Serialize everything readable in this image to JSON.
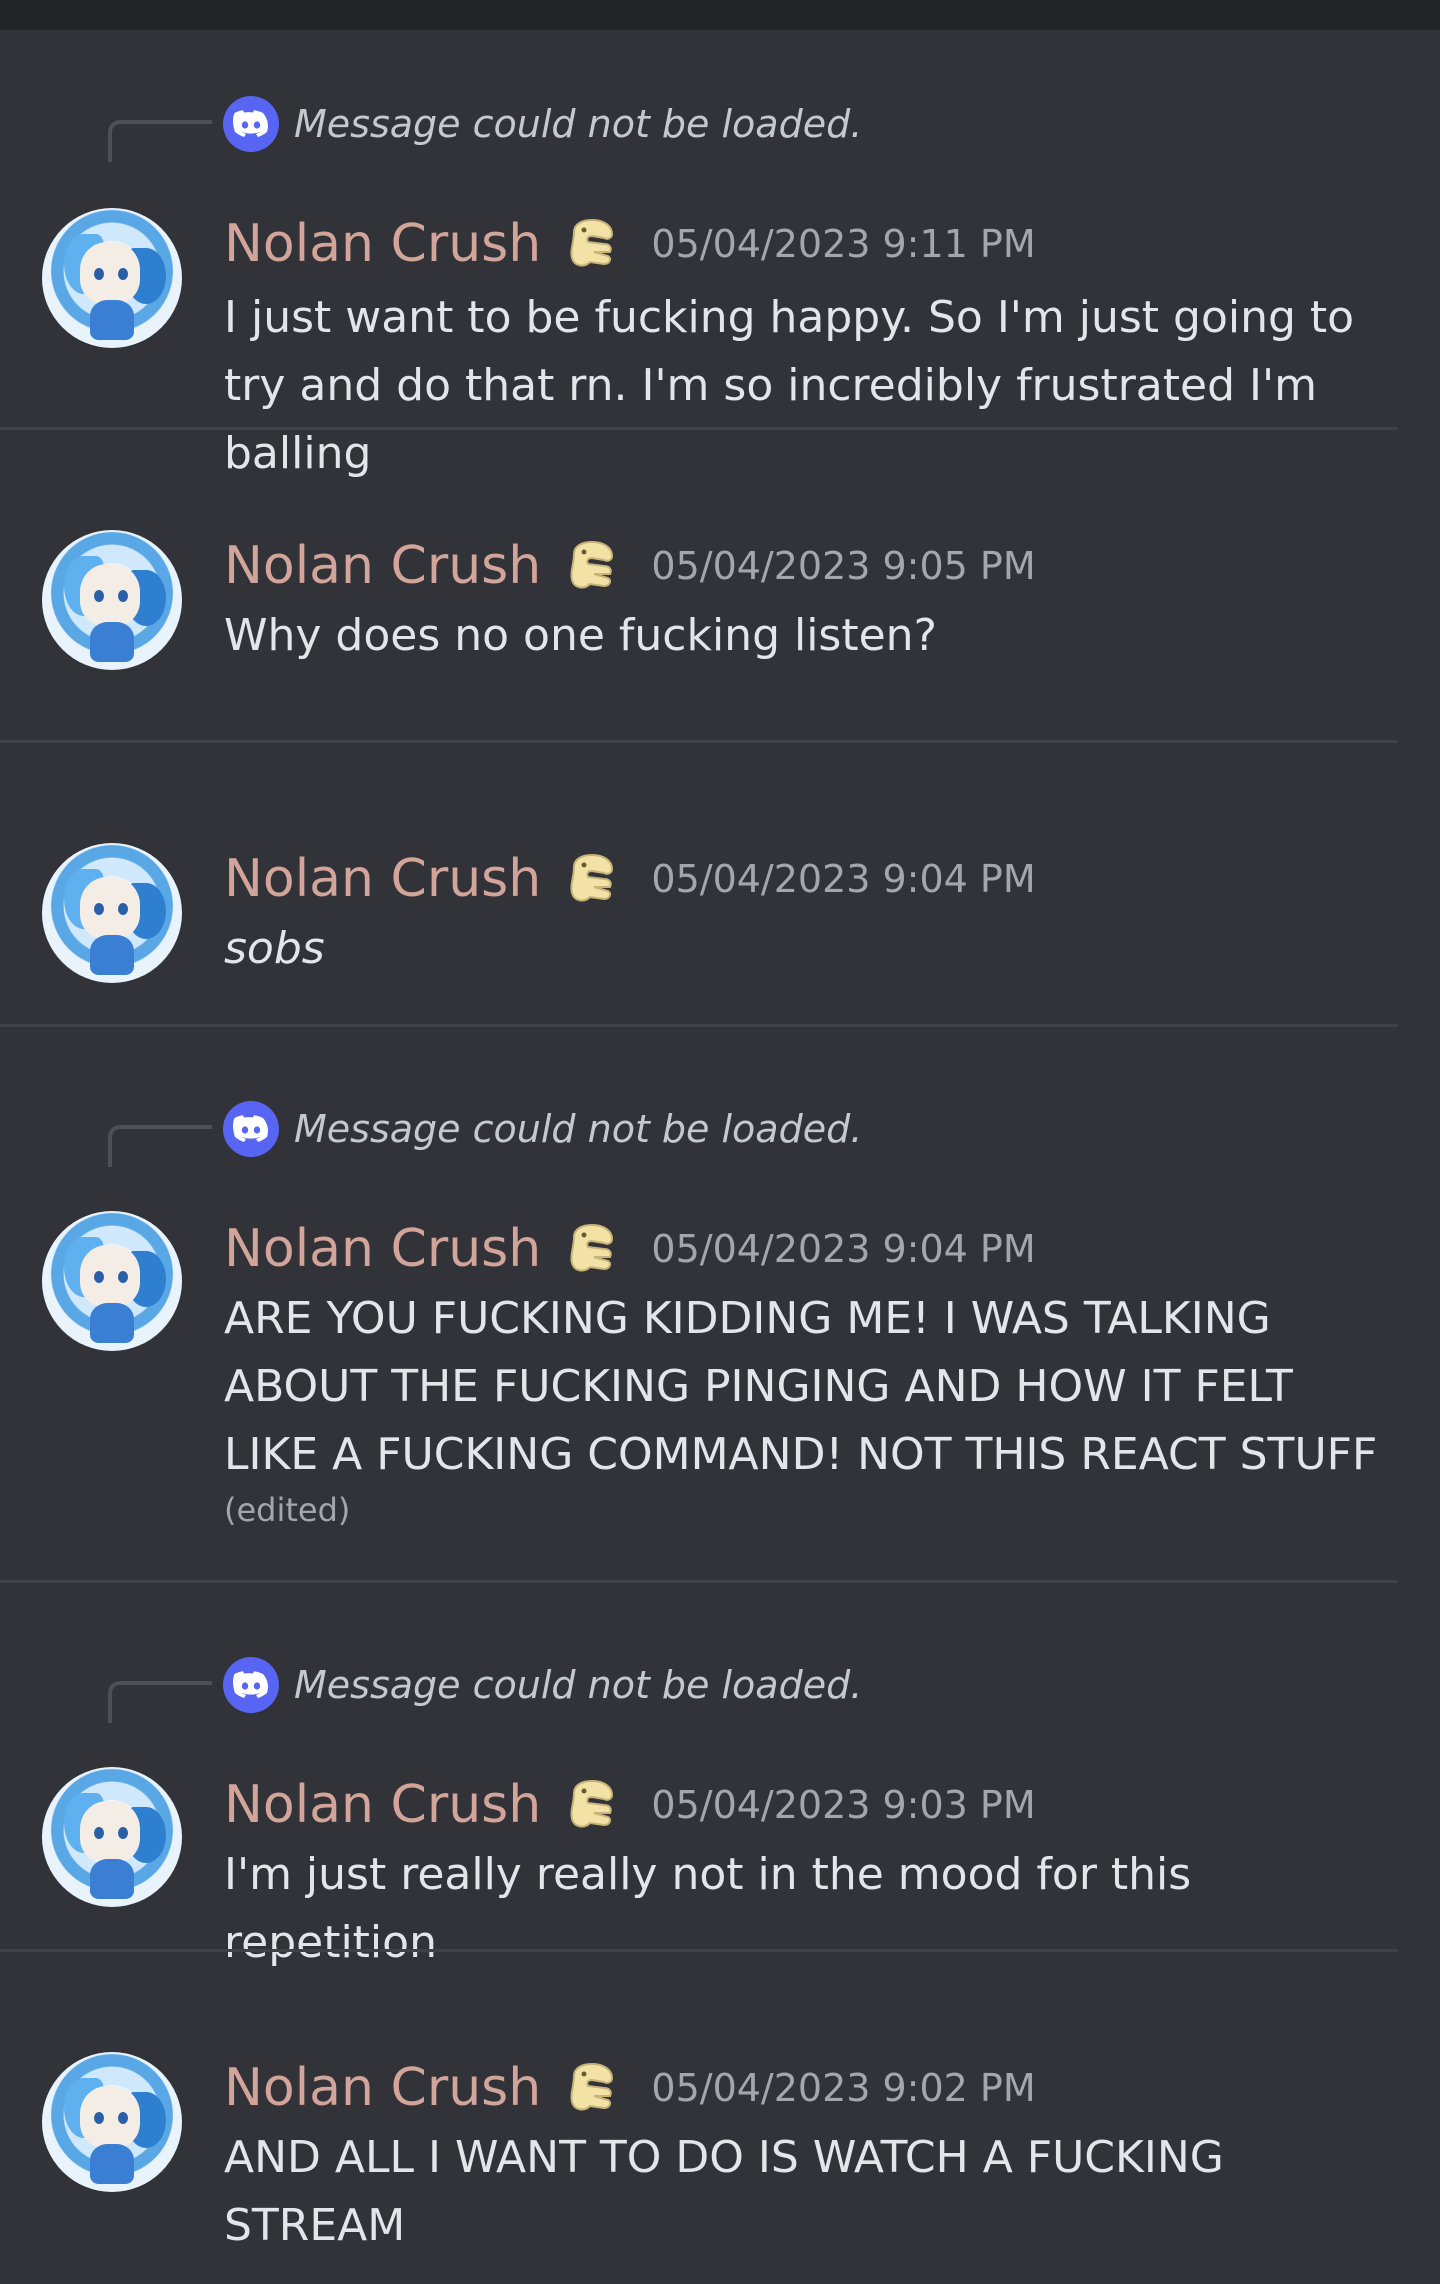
{
  "reply_placeholder": "Message could not be loaded.",
  "messages": [
    {
      "author": "Nolan Crush",
      "timestamp": "05/04/2023 9:11 PM",
      "text": "I just want to be fucking happy. So I'm just going to try and do that rn. I'm so incredibly frustrated I'm balling",
      "has_reply": true,
      "italic": false,
      "edited": ""
    },
    {
      "author": "Nolan Crush",
      "timestamp": "05/04/2023 9:05 PM",
      "text": "Why does no one fucking listen?",
      "has_reply": false,
      "italic": false,
      "edited": ""
    },
    {
      "author": "Nolan Crush",
      "timestamp": "05/04/2023 9:04 PM",
      "text": "sobs",
      "has_reply": false,
      "italic": true,
      "edited": ""
    },
    {
      "author": "Nolan Crush",
      "timestamp": "05/04/2023 9:04 PM",
      "text": "ARE YOU FUCKING KIDDING ME! I WAS TALKING ABOUT THE FUCKING PINGING AND HOW IT FELT LIKE A FUCKING COMMAND! NOT THIS REACT STUFF",
      "has_reply": true,
      "italic": false,
      "edited": "(edited)"
    },
    {
      "author": "Nolan Crush",
      "timestamp": "05/04/2023 9:03 PM",
      "text": "I'm just really really not in the mood for this repetition",
      "has_reply": true,
      "italic": false,
      "edited": ""
    },
    {
      "author": "Nolan Crush",
      "timestamp": "05/04/2023 9:02 PM",
      "text": "AND ALL I WANT TO DO IS WATCH A FUCKING STREAM",
      "has_reply": false,
      "italic": false,
      "edited": ""
    }
  ],
  "colors": {
    "background": "#313338",
    "author": "#d2a49a",
    "reply_icon": "#5865f2"
  },
  "icons": {
    "reply_icon": "discord-logo-icon",
    "badge": "pointing-hand-badge-icon"
  }
}
